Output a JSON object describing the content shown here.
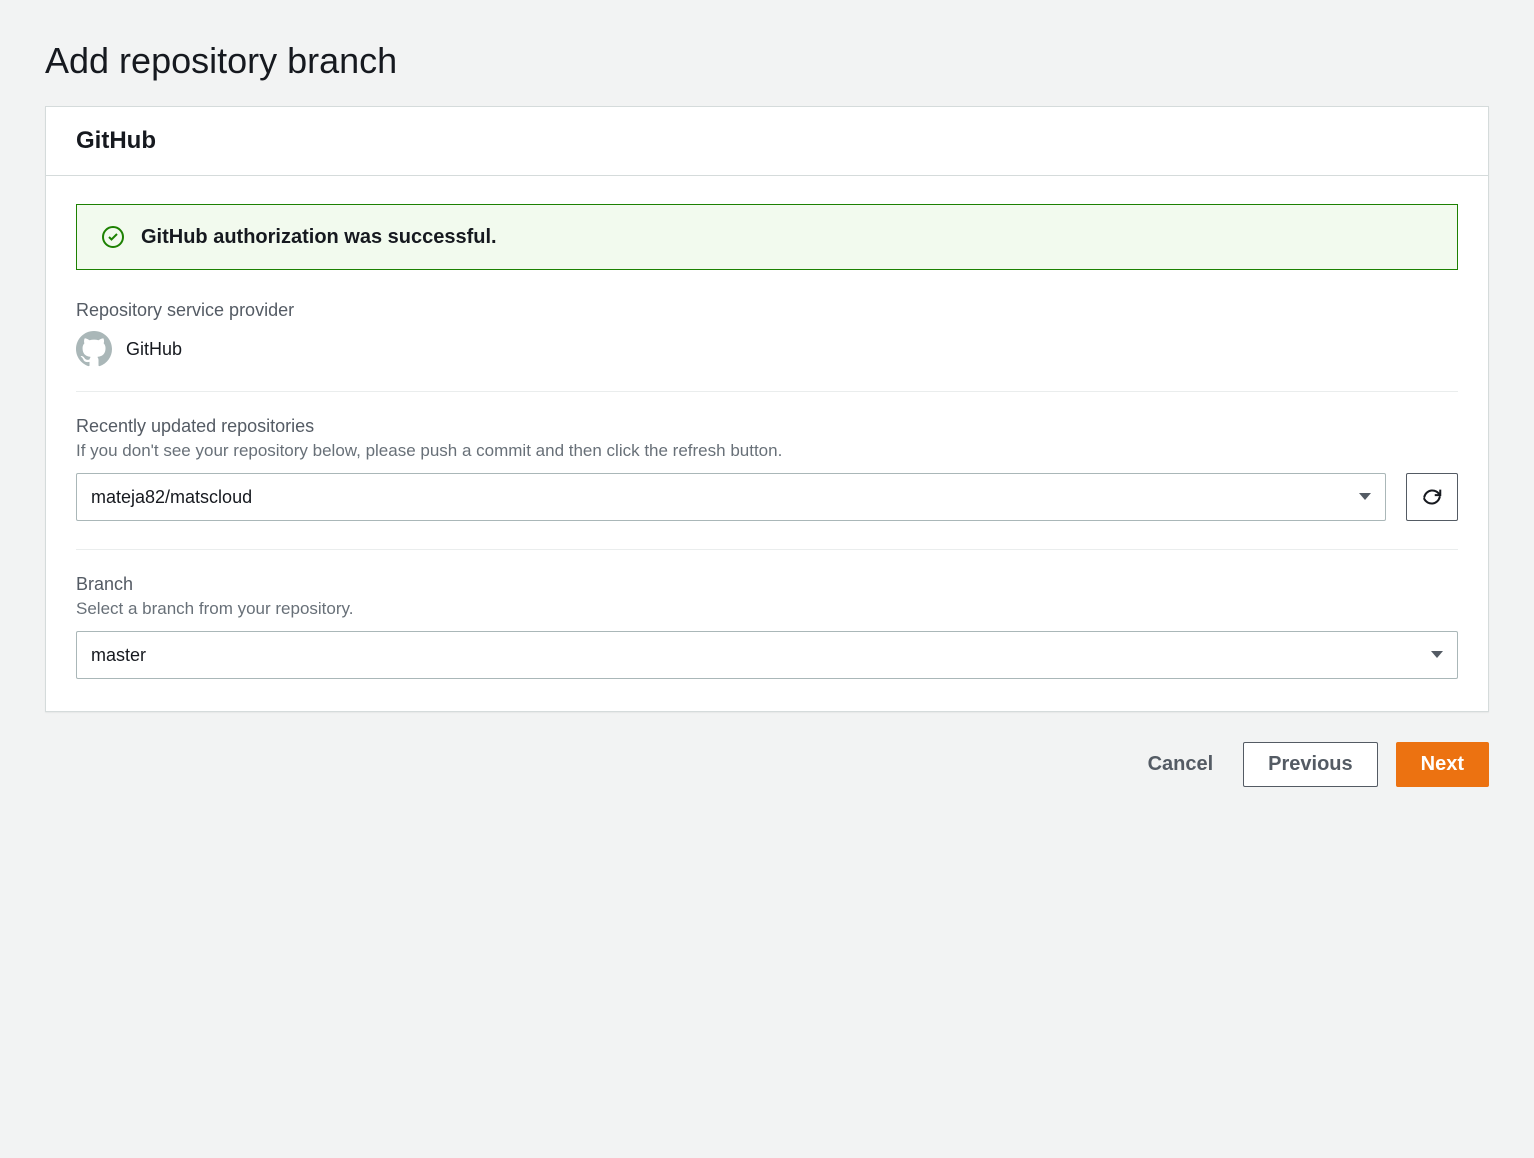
{
  "page": {
    "title": "Add repository branch"
  },
  "card": {
    "headerTitle": "GitHub"
  },
  "alert": {
    "message": "GitHub authorization was successful."
  },
  "provider": {
    "label": "Repository service provider",
    "name": "GitHub"
  },
  "repositories": {
    "label": "Recently updated repositories",
    "description": "If you don't see your repository below, please push a commit and then click the refresh button.",
    "selected": "mateja82/matscloud"
  },
  "branch": {
    "label": "Branch",
    "description": "Select a branch from your repository.",
    "selected": "master"
  },
  "actions": {
    "cancel": "Cancel",
    "previous": "Previous",
    "next": "Next"
  }
}
